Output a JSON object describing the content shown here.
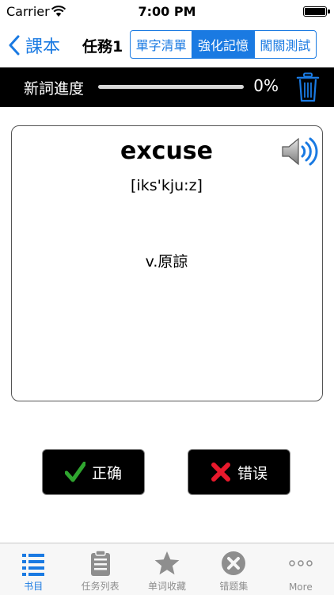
{
  "status_bar": {
    "carrier": "Carrier",
    "time": "7:00 PM"
  },
  "nav": {
    "back_label": "課本",
    "title": "任務1",
    "segments": [
      "單字清單",
      "強化記憶",
      "闖關測試"
    ],
    "selected_segment": "強化記憶"
  },
  "progress": {
    "label": "新詞進度",
    "value_text": "0%",
    "fraction": 0
  },
  "card": {
    "word": "excuse",
    "phonetic": "[iks'kju:z]",
    "meaning": "v.原諒"
  },
  "answers": {
    "correct_label": "正确",
    "wrong_label": "错误"
  },
  "tabs": [
    {
      "label": "书目",
      "icon": "list-icon",
      "active": true
    },
    {
      "label": "任务列表",
      "icon": "clipboard-icon",
      "active": false
    },
    {
      "label": "单词收藏",
      "icon": "star-icon",
      "active": false
    },
    {
      "label": "错题集",
      "icon": "x-circle-icon",
      "active": false
    },
    {
      "label": "More",
      "icon": "more-icon",
      "active": false
    }
  ],
  "colors": {
    "accent": "#1a7ae2",
    "bar_background": "#000000",
    "correct": "#1e8c1e",
    "wrong": "#e8192c"
  }
}
